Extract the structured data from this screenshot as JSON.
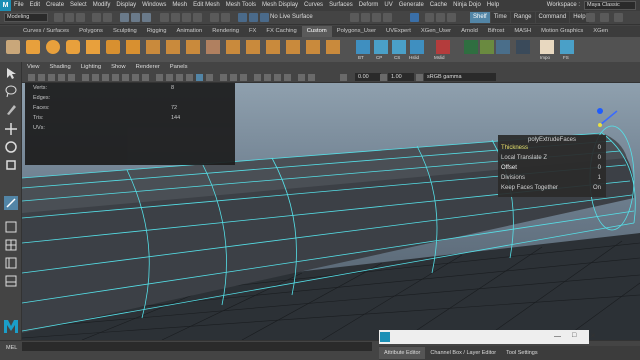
{
  "menubar": {
    "logo": "M",
    "items": [
      "File",
      "Edit",
      "Create",
      "Select",
      "Modify",
      "Display",
      "Windows",
      "Mesh",
      "Edit Mesh",
      "Mesh Tools",
      "Mesh Display",
      "Curves",
      "Surfaces",
      "Deform",
      "UV",
      "Generate",
      "Cache",
      "Ninja Dojo",
      "Help"
    ],
    "workspace_label": "Workspace :",
    "workspace_value": "Maya Classic"
  },
  "statusline": {
    "mode": "Modeling",
    "live_surface": "No Live Surface",
    "sidebar_tabs": [
      "Shelf",
      "Time",
      "Range",
      "Command",
      "Help"
    ],
    "selected_tab": "Shelf"
  },
  "shelf": {
    "tabs": [
      "Curves / Surfaces",
      "Polygons",
      "Sculpting",
      "Rigging",
      "Animation",
      "Rendering",
      "FX",
      "FX Caching",
      "Custom",
      "Polygons_User",
      "UVExpert",
      "XGen_User",
      "Arnold",
      "Bifrost",
      "MASH",
      "Motion Graphics",
      "XGen"
    ],
    "selected_tab": "Custom",
    "icon_labels": [
      "BT",
      "CP",
      "CS",
      "Hslid",
      "Mslid",
      "Impo",
      "FS"
    ]
  },
  "panel": {
    "menus": [
      "View",
      "Shading",
      "Lighting",
      "Show",
      "Renderer",
      "Panels"
    ],
    "value1": "0.00",
    "value2": "1.00",
    "color_space": "sRGB gamma"
  },
  "hud": {
    "labels": [
      "Verts:",
      "Edges:",
      "Faces:",
      "Tris:",
      "UVs:"
    ],
    "values": [
      "8",
      "",
      "72",
      "144",
      ""
    ]
  },
  "extrude": {
    "title": "polyExtrudeFaces",
    "rows": [
      {
        "label": "Thickness",
        "value": "0"
      },
      {
        "label": "Local Translate Z",
        "value": "0"
      },
      {
        "label": "Offset",
        "value": "0"
      },
      {
        "label": "Divisions",
        "value": "1"
      },
      {
        "label": "Keep Faces Together",
        "value": "On"
      }
    ]
  },
  "cmdline": {
    "label": "MEL"
  },
  "bottom_tabs": [
    "Attribute Editor",
    "Channel Box / Layer Editor",
    "Tool Settings"
  ],
  "colors": {
    "accent": "#5285a6",
    "thickness_highlight": "#f0e86a",
    "wireframe": "#55e0e8"
  }
}
